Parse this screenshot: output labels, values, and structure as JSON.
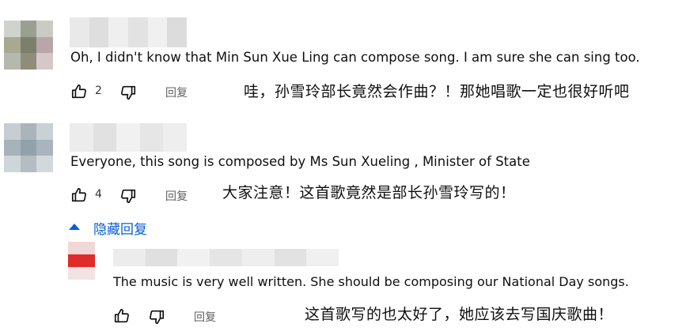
{
  "comments": [
    {
      "text": "Oh, I didn't know that Min Sun Xue Ling can compose song. I am sure she can sing too.",
      "likes": "2",
      "reply_label": "回复",
      "translation": "哇，孙雪玲部长竟然会作曲？！那她唱歌一定也很好听吧"
    },
    {
      "text": "Everyone, this song is composed by Ms Sun Xueling , Minister of State",
      "likes": "4",
      "reply_label": "回复",
      "translation": "大家注意！这首歌竟然是部长孙雪玲写的！"
    }
  ],
  "hide_replies_label": "隐藏回复",
  "reply": {
    "text": "The music is very well written. She should be composing our National Day songs.",
    "reply_label": "回复",
    "translation": "这首歌写的也太好了，她应该去写国庆歌曲！"
  },
  "icons": [
    "thumb-up-icon",
    "thumb-down-icon",
    "caret-up-icon"
  ],
  "colors": {
    "link": "#065fd4",
    "text": "#0f0f0f",
    "muted": "#606060"
  }
}
